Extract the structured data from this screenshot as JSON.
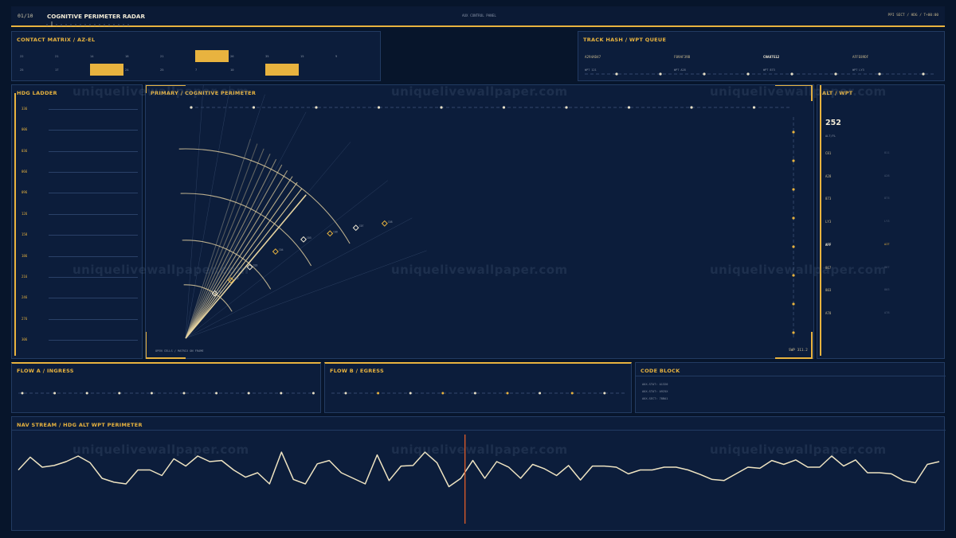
{
  "header": {
    "page_counter": "01/10",
    "title": "COGNITIVE PERIMETER RADAR",
    "center_label": "AUX CONTROL PANEL",
    "right_label": "PPI SECT / HDG / T+00:00"
  },
  "contact_matrix": {
    "title": "CONTACT MATRIX / AZ-EL",
    "row1": [
      "22",
      "21",
      "14",
      "18",
      "21",
      "",
      "26",
      "35",
      "15",
      "9"
    ],
    "row2": [
      "25",
      "17",
      "",
      "24",
      "25",
      "7",
      "10",
      ""
    ],
    "row1_highlight": [
      5
    ],
    "row2_highlight": [
      2,
      7
    ]
  },
  "track_hash": {
    "title": "TRACK HASH / WPT QUEUE",
    "hashes": [
      "A294AD47",
      "F09AF39B",
      "C9A87512",
      "AFFE89DF"
    ],
    "hash_active_index": 2,
    "wpts": [
      "WPT 121",
      "WPT A28",
      "WPT 873",
      "WPT LY3"
    ]
  },
  "hdg_ladder": {
    "title": "HDG LADDER",
    "values": [
      "336",
      "006",
      "036",
      "066",
      "096",
      "126",
      "158",
      "186",
      "216",
      "246",
      "276",
      "306"
    ]
  },
  "primary": {
    "title": "PRIMARY / COGNITIVE PERIMETER",
    "footer_left": "OPEN CELLS / MATRIX ON FRAME",
    "footer_right": "SWP 311.2",
    "contacts": [
      {
        "label": "C01",
        "r": 0.24,
        "ang": 57
      },
      {
        "label": "C02",
        "r": 0.33,
        "ang": 52
      },
      {
        "label": "C03",
        "r": 0.43,
        "ang": 48
      },
      {
        "label": "C04",
        "r": 0.56,
        "ang": 44
      },
      {
        "label": "C05",
        "r": 0.69,
        "ang": 40
      },
      {
        "label": "C06",
        "r": 0.8,
        "ang": 36
      },
      {
        "label": "C07",
        "r": 0.91,
        "ang": 33
      },
      {
        "label": "C08",
        "r": 1.03,
        "ang": 30
      }
    ]
  },
  "alt_wpt": {
    "title": "ALT / WPT",
    "value": "252",
    "sub": "ALT/FL",
    "rows": [
      {
        "code": "C81",
        "val": "811"
      },
      {
        "code": "A28",
        "val": "A28"
      },
      {
        "code": "873",
        "val": "873"
      },
      {
        "code": "LY3",
        "val": "LY3"
      },
      {
        "code": "AFF",
        "val": "AIT"
      },
      {
        "code": "867",
        "val": "867"
      },
      {
        "code": "803",
        "val": "803"
      },
      {
        "code": "A78",
        "val": "A78"
      }
    ],
    "active_index": 4
  },
  "flow_a": {
    "title": "FLOW A / INGRESS"
  },
  "flow_b": {
    "title": "FLOW B / EGRESS"
  },
  "code_block": {
    "title": "CODE BLOCK",
    "lines": [
      "AUX-STAT: A1320",
      "AUX-STAT: A925X",
      "AUX-SECT: 78BA1"
    ]
  },
  "nav_stream": {
    "title": "NAV STREAM / HDG ALT WPT PERIMETER",
    "values": [
      0.55,
      0.78,
      0.6,
      0.63,
      0.7,
      0.8,
      0.68,
      0.4,
      0.33,
      0.3,
      0.55,
      0.55,
      0.45,
      0.75,
      0.62,
      0.8,
      0.7,
      0.72,
      0.55,
      0.42,
      0.5,
      0.3,
      0.87,
      0.38,
      0.3,
      0.66,
      0.72,
      0.5,
      0.4,
      0.3,
      0.82,
      0.36,
      0.62,
      0.63,
      0.87,
      0.68,
      0.25,
      0.4,
      0.72,
      0.4,
      0.7,
      0.6,
      0.4,
      0.65,
      0.57,
      0.45,
      0.63,
      0.37,
      0.62,
      0.62,
      0.6,
      0.48,
      0.55,
      0.55,
      0.6,
      0.6,
      0.55,
      0.47,
      0.38,
      0.36,
      0.48,
      0.6,
      0.58,
      0.72,
      0.65,
      0.73,
      0.6,
      0.6,
      0.8,
      0.62,
      0.73,
      0.5,
      0.5,
      0.48,
      0.36,
      0.32,
      0.65,
      0.7
    ],
    "cursor_position": 0.485
  },
  "watermark": "uniquelivewallpaper.com",
  "colors": {
    "accent": "#e8b33f",
    "line": "#efe4c2",
    "cursor": "#d65a2a",
    "panel": "#0c1d3b"
  }
}
